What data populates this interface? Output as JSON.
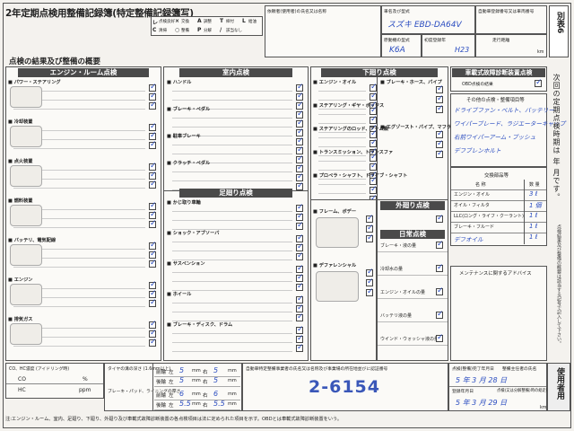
{
  "header": {
    "title": "2年定期点検用整備記録簿(特定整備記録簿写)",
    "owner_label": "依頼者(使用者)の氏名又は名称",
    "car_model_label": "車名及び型式",
    "car_model_value": "スズキ EBD-DA64V",
    "registration_label": "自動車登録番号又は車両番号",
    "engine_label": "原動機の型式",
    "engine_value": "K6A",
    "first_reg_label": "初度登録年",
    "first_reg_value": "H23",
    "odometer_label": "走行距離",
    "odometer_unit": "km",
    "appendix": "別表6"
  },
  "legend": {
    "cols": [
      {
        "sym": "レ",
        "txt": "点検良好"
      },
      {
        "sym": "×",
        "txt": "交換"
      },
      {
        "sym": "A",
        "txt": "調整"
      },
      {
        "sym": "T",
        "txt": "締付"
      },
      {
        "sym": "L",
        "txt": "給油"
      },
      {
        "sym": "C",
        "txt": "清掃"
      },
      {
        "sym": "○",
        "txt": "整備"
      },
      {
        "sym": "P",
        "txt": "分解"
      },
      {
        "sym": "/",
        "txt": "該当なし"
      }
    ]
  },
  "result_heading": "点検の結果及び整備の概要",
  "sections": {
    "engine_room": "エンジン・ルーム点検",
    "interior": "室内点検",
    "underbody": "下廻り点検",
    "obd": "車載式故障診断装置点検",
    "footwork": "足廻り点検",
    "exterior": "外廻り点検",
    "daily": "日常点検"
  },
  "engine_items": [
    "パワー・ステアリング",
    "冷却装置",
    "点火装置",
    "燃料装置",
    "バッテリ、電気配線",
    "エンジン",
    "排気ガス"
  ],
  "interior_items": [
    "ハンドル",
    "ブレーキ・ペダル",
    "駐車ブレーキ",
    "クラッチ・ペダル"
  ],
  "underbody_items": [
    "エンジン・オイル",
    "ステアリング・ギヤ・ボックス",
    "ステアリングのロッド、アーム類",
    "トランスミッション、トランスファ",
    "プロペラ・シャフト、ドライブ・シャフト",
    "ブレーキ・ホース、パイプ",
    "エグゾースト・パイプ、マフラ",
    "フレーム、ボデー",
    "デファレンシャル"
  ],
  "footwork_items": [
    "かじ取り車輪",
    "ショック・アブソーバ",
    "サスペンション",
    "ホイール",
    "ブレーキ・ディスク、ドラム"
  ],
  "daily_items": [
    "ブレーキ・液の量",
    "冷却水の量",
    "エンジン・オイルの量",
    "バッテリ液の量",
    "ウインド・ウォッシャ液の量"
  ],
  "obd_note": "OBD点検の結果",
  "next_inspection": "次回の定期点検時期は 年 月です。",
  "other_items_label": "その他の点検・整備項目等",
  "other_items_handwritten": [
    "ドライブファン・ベルト、バッテリー",
    "ワイパーブレード、ラジエーターキャップ",
    "右前ワイパーアーム・ブッシュ",
    "デフブレンホルト"
  ],
  "parts_label": "交換部品等",
  "parts_cols": [
    "名 称",
    "数 量"
  ],
  "parts": [
    {
      "name": "エンジン・オイル",
      "qty": "3 ℓ"
    },
    {
      "name": "オイル・フィルタ",
      "qty": "1 個"
    },
    {
      "name": "LLC(ロング・ライフ・クーラント)",
      "qty": "1 ℓ"
    },
    {
      "name": "ブレーキ・フルード",
      "qty": "1 ℓ"
    },
    {
      "name": "デフオイル",
      "qty": "1 ℓ"
    }
  ],
  "maintenance_advice": "メンテナンスに関するアドバイス",
  "co_hc": {
    "label": "CO、HC濃度 (アイドリング時)",
    "co": "CO",
    "hc": "HC",
    "unit_pct": "%",
    "unit_ppm": "ppm"
  },
  "tire": {
    "label": "タイヤの溝の深さ (1.6mm以上)",
    "brake_label": "ブレーキ・パッド、ライニングの厚さ",
    "front_row": "前輪",
    "rear_row": "後輪",
    "left": "左",
    "right": "右",
    "unit": "mm",
    "front_left": "5",
    "front_right": "5",
    "rear_left": "5",
    "rear_right": "5",
    "pad_front_left": "6",
    "pad_front_right": "6",
    "pad_rear_left": "5.5",
    "pad_rear_right": "5.5"
  },
  "business": {
    "label": "自動車特定整備事業者の氏名又は名称及び事業場の所在地並びに認証番号",
    "stamp": "2-6154"
  },
  "dates": {
    "completion_label": "点検(整備)完了年月日",
    "completion": "5 年 3 月 28 日",
    "completion_h": "整備主任者の氏名",
    "inspect_label": "点検(又は分解整備)時の総走行距離",
    "inspect_date_label": "登録年月日",
    "inspect_date": "5 年 3 月 29 日",
    "odometer_unit": "km"
  },
  "user_tab": "使用者用",
  "footer_note": "注:エンジン・ルーム、室内、足廻り、下廻り、外廻り及び車載式故障診断装置の各点検項目は法に定められた項目を示す。OBDとは車載式故障診断装置をいう。",
  "side_note": "点検結果及び整備の概要は該当する記号で記入して下さい。"
}
